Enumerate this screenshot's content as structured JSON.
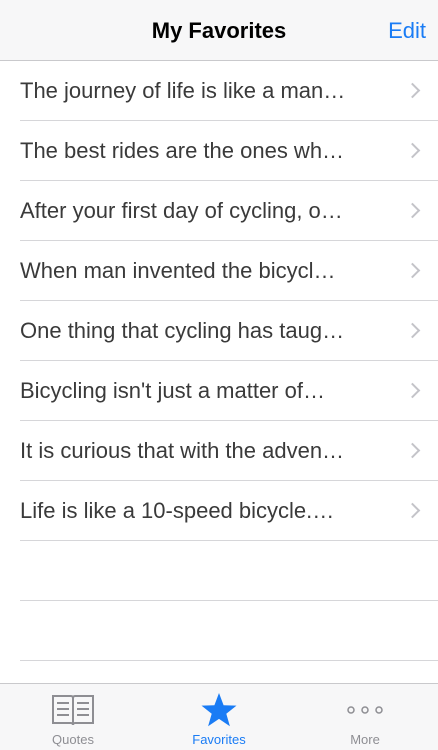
{
  "navbar": {
    "title": "My Favorites",
    "edit_label": "Edit"
  },
  "favorites": [
    "The journey of life is like a man…",
    "The best rides are the ones wh…",
    "After your first day of cycling, o…",
    "When man invented the bicycl…",
    "One thing that cycling has taug…",
    "Bicycling isn't just a matter of…",
    "It is curious that with the adven…",
    "Life is like a 10-speed bicycle.…"
  ],
  "tabbar": {
    "tabs": [
      {
        "label": "Quotes",
        "icon": "book-icon"
      },
      {
        "label": "Favorites",
        "icon": "star-icon"
      },
      {
        "label": "More",
        "icon": "more-dots-icon"
      }
    ],
    "active": "Favorites"
  },
  "colors": {
    "accent": "#1a7cf5",
    "inactive": "#8e8e93"
  }
}
